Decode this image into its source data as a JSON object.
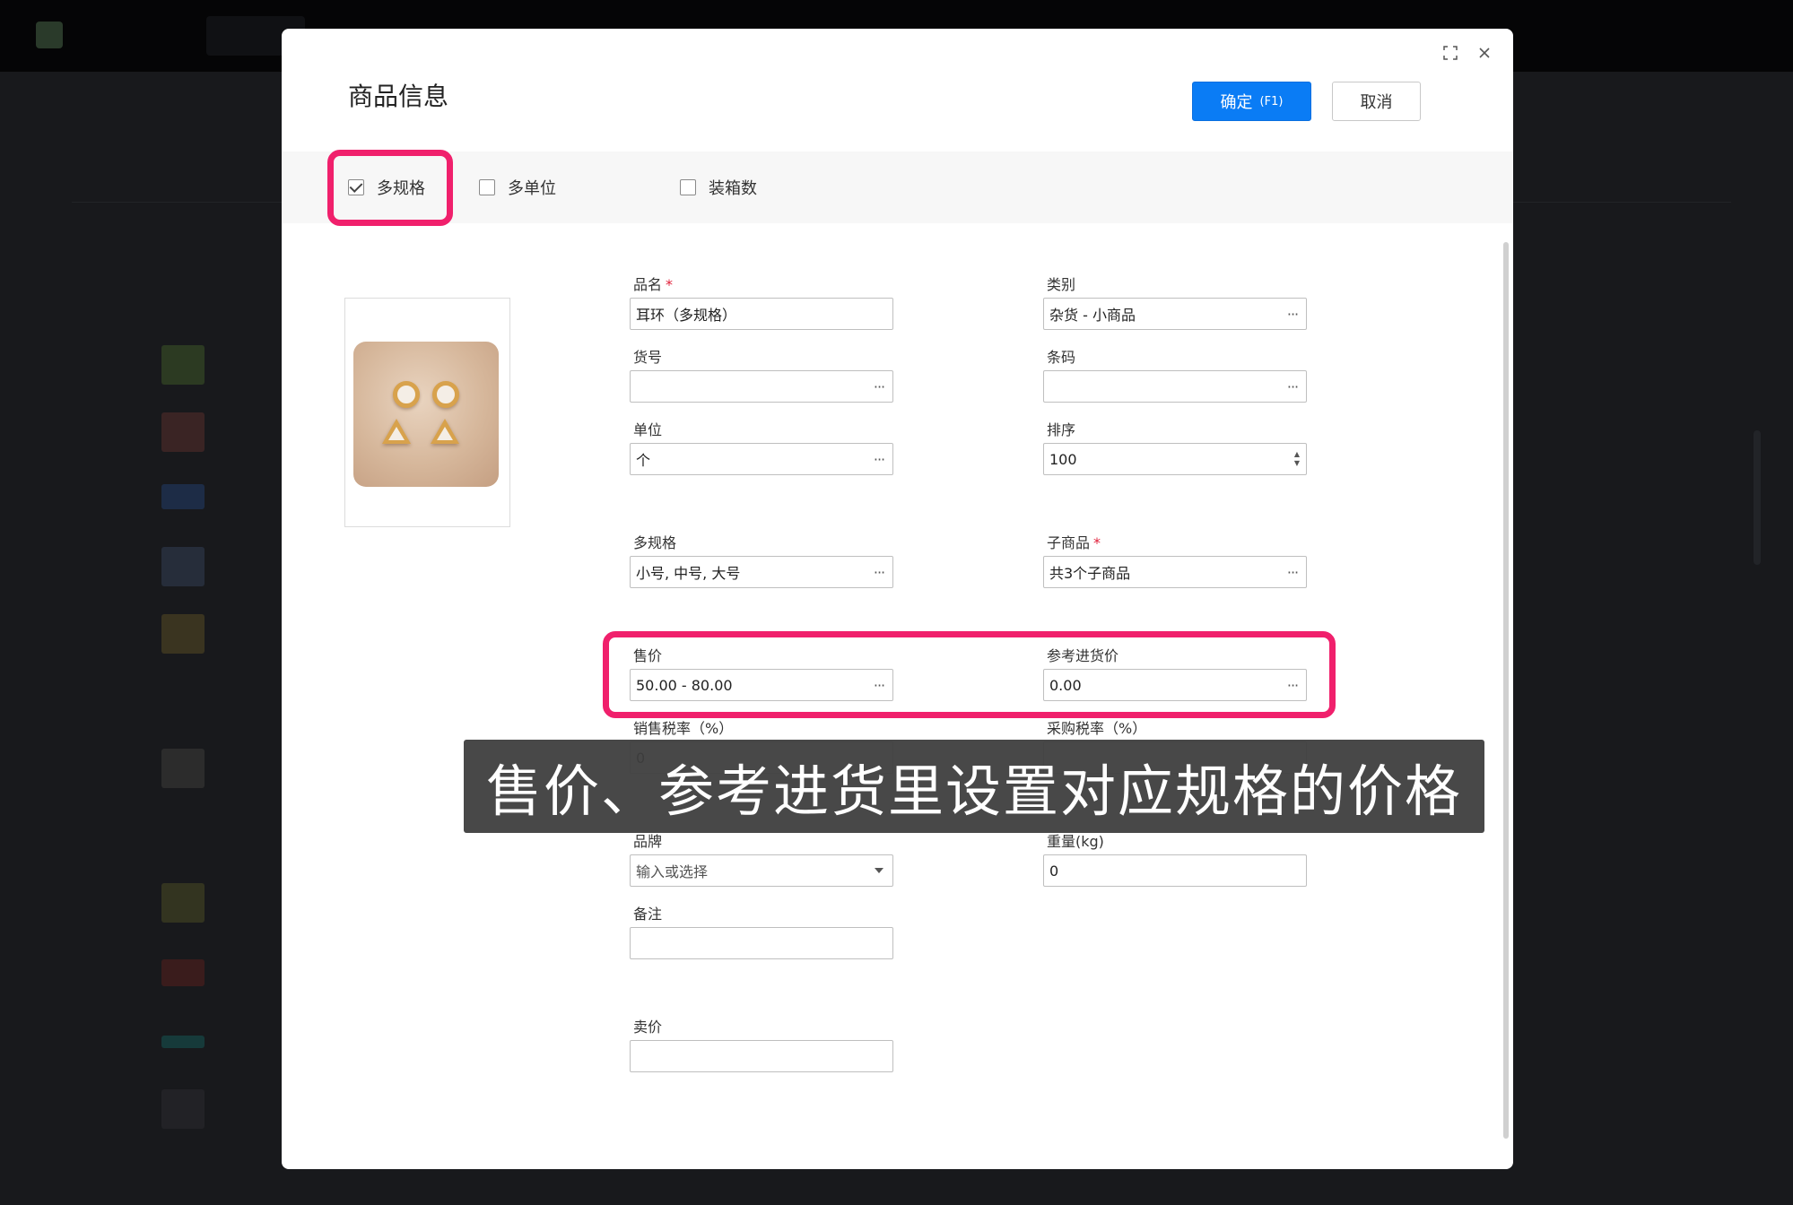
{
  "modal": {
    "title": "商品信息",
    "confirm_label": "确定",
    "confirm_key": "(F1)",
    "cancel_label": "取消"
  },
  "options": [
    {
      "label": "多规格",
      "checked": true
    },
    {
      "label": "多单位",
      "checked": false
    },
    {
      "label": "装箱数",
      "checked": false
    }
  ],
  "form": {
    "name": {
      "label": "品名",
      "value": "耳环（多规格）",
      "required": true
    },
    "category": {
      "label": "类别",
      "value": "杂货 - 小商品"
    },
    "item_no": {
      "label": "货号",
      "value": ""
    },
    "barcode": {
      "label": "条码",
      "value": ""
    },
    "unit": {
      "label": "单位",
      "value": "个"
    },
    "sort": {
      "label": "排序",
      "value": "100"
    },
    "specs": {
      "label": "多规格",
      "value": "小号, 中号, 大号"
    },
    "children": {
      "label": "子商品",
      "value": "共3个子商品",
      "required": true
    },
    "price": {
      "label": "售价",
      "value": "50.00 - 80.00"
    },
    "ref_cost": {
      "label": "参考进货价",
      "value": "0.00"
    },
    "sales_tax": {
      "label": "销售税率（%）",
      "value": "0"
    },
    "purchase_tax": {
      "label": "采购税率（%）"
    },
    "brand": {
      "label": "品牌",
      "placeholder": "输入或选择"
    },
    "weight": {
      "label": "重量(kg)",
      "value": "0"
    },
    "remark": {
      "label": "备注",
      "value": ""
    },
    "sell_price": {
      "label": "卖价",
      "value": ""
    }
  },
  "caption": "售价、参考进货里设置对应规格的价格",
  "colors": {
    "primary": "#0a7cf5",
    "highlight": "#f0206c",
    "required": "#e0203a"
  }
}
